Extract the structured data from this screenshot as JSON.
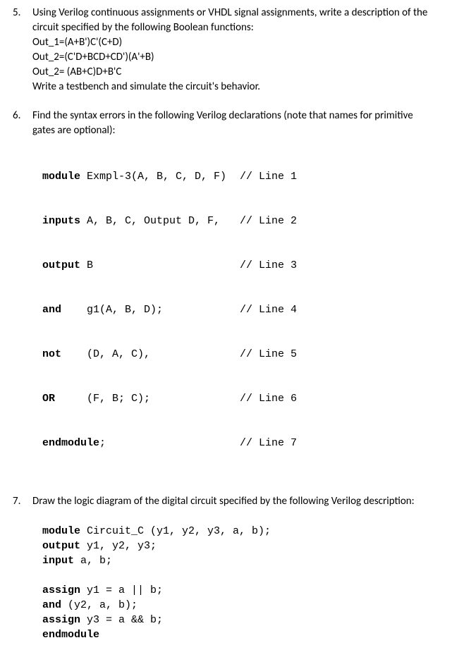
{
  "q5": {
    "num": "5.",
    "text1": "Using Verilog continuous assignments or VHDL signal assignments, write a description of the",
    "text2": "circuit specified by the following Boolean functions:",
    "eq1": "Out_1=(A+B')C'(C+D)",
    "eq2": "Out_2=(C'D+BCD+CD')(A'+B)",
    "eq3": "Out_2= (AB+C)D+B'C",
    "text3": "Write a testbench and simulate the circuit's behavior."
  },
  "q6": {
    "num": "6.",
    "text1": "Find the syntax errors in the following Verilog declarations (note that names for primitive",
    "text2": "gates are optional):",
    "lines": [
      {
        "kw": "module",
        "rest": " Exmpl-3(A, B, C, D, F)",
        "comment": "// Line 1"
      },
      {
        "kw": "inputs",
        "rest": " A, B, C, Output D, F,",
        "comment": "// Line 2"
      },
      {
        "kw": "output",
        "rest": " B",
        "comment": "// Line 3"
      },
      {
        "kw": "and",
        "rest": "    g1(A, B, D);",
        "comment": "// Line 4"
      },
      {
        "kw": "not",
        "rest": "    (D, A, C),",
        "comment": "// Line 5"
      },
      {
        "kw": "OR",
        "rest": "     (F, B; C);",
        "comment": "// Line 6"
      },
      {
        "kw": "endmodule",
        "rest": ";",
        "comment": "// Line 7"
      }
    ]
  },
  "q7": {
    "num": "7.",
    "text1": "Draw the logic diagram of the digital circuit specified by the following Verilog description:",
    "l1_kw": "module",
    "l1_rest": " Circuit_C (y1, y2, y3, a, b);",
    "l2_kw": "output",
    "l2_rest": " y1, y2, y3;",
    "l3_kw": "input",
    "l3_rest": " a, b;",
    "l4_kw": "assign",
    "l4_rest": " y1 = a || b;",
    "l5_kw": "and",
    "l5_rest": " (y2, a, b);",
    "l6_kw": "assign",
    "l6_rest": " y3 = a && b;",
    "l7_kw": "endmodule",
    "l7_rest": ""
  }
}
